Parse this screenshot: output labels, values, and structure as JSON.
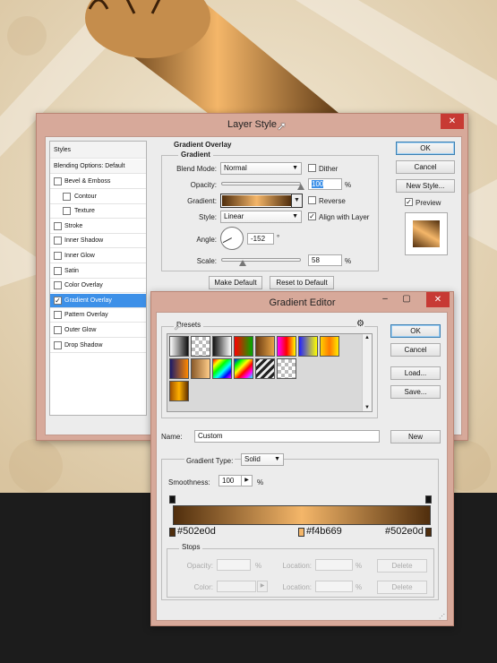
{
  "layer_style": {
    "title": "Layer Style",
    "styles_header": "Styles",
    "blending_options": "Blending Options: Default",
    "styles": [
      {
        "label": "Bevel & Emboss",
        "checked": false,
        "indent": false
      },
      {
        "label": "Contour",
        "checked": false,
        "indent": true
      },
      {
        "label": "Texture",
        "checked": false,
        "indent": true
      },
      {
        "label": "Stroke",
        "checked": false,
        "indent": false
      },
      {
        "label": "Inner Shadow",
        "checked": false,
        "indent": false
      },
      {
        "label": "Inner Glow",
        "checked": false,
        "indent": false
      },
      {
        "label": "Satin",
        "checked": false,
        "indent": false
      },
      {
        "label": "Color Overlay",
        "checked": false,
        "indent": false
      },
      {
        "label": "Gradient Overlay",
        "checked": true,
        "indent": false
      },
      {
        "label": "Pattern Overlay",
        "checked": false,
        "indent": false
      },
      {
        "label": "Outer Glow",
        "checked": false,
        "indent": false
      },
      {
        "label": "Drop Shadow",
        "checked": false,
        "indent": false
      }
    ],
    "section_title": "Gradient Overlay",
    "group_title": "Gradient",
    "blend_mode_label": "Blend Mode:",
    "blend_mode_value": "Normal",
    "dither_label": "Dither",
    "opacity_label": "Opacity:",
    "opacity_value": "100",
    "opacity_unit": "%",
    "gradient_label": "Gradient:",
    "reverse_label": "Reverse",
    "style_label": "Style:",
    "style_value": "Linear",
    "align_label": "Align with Layer",
    "angle_label": "Angle:",
    "angle_value": "-152",
    "angle_unit": "°",
    "scale_label": "Scale:",
    "scale_value": "58",
    "scale_unit": "%",
    "make_default": "Make Default",
    "reset_default": "Reset to Default",
    "ok": "OK",
    "cancel": "Cancel",
    "new_style": "New Style...",
    "preview_label": "Preview",
    "preview_checked": true,
    "dither_checked": false,
    "reverse_checked": false,
    "align_checked": true,
    "opacity_fraction": 1.0,
    "scale_fraction": 0.58
  },
  "gradient_editor": {
    "title": "Gradient Editor",
    "presets_label": "Presets",
    "ok": "OK",
    "cancel": "Cancel",
    "load": "Load...",
    "save": "Save...",
    "name_label": "Name:",
    "name_value": "Custom",
    "new_button": "New",
    "type_label": "Gradient Type:",
    "type_value": "Solid",
    "smoothness_label": "Smoothness:",
    "smoothness_value": "100",
    "smoothness_unit": "%",
    "stops_title": "Stops",
    "opacity_label": "Opacity:",
    "opacity_unit": "%",
    "location_label": "Location:",
    "location_unit": "%",
    "delete_label": "Delete",
    "color_label": "Color:",
    "color_stops": [
      {
        "hex": "#502e0d",
        "location": 0
      },
      {
        "hex": "#f4b669",
        "location": 50
      },
      {
        "hex": "#502e0d",
        "location": 100
      }
    ],
    "presets": [
      "#ffffff,#111111",
      "checker",
      "#111111,#ffffff",
      "#ff0000,#00aa00",
      "#6b3c12,#e8a447",
      "#ff00ff,#ff0000,#ffff00",
      "#2020ff,#ffff00",
      "#ffd000,#ff7a00,#ffea00",
      "#1a1a6a,#ff8800",
      "#8a5a2a,#ffcc88",
      "rainbow1",
      "rainbow2",
      "stripes",
      "checker",
      "#a05000,#ffb000,#603000"
    ]
  },
  "colors": {
    "window_frame": "#d7a99a",
    "close_button": "#c73a34",
    "selection": "#3d90e8",
    "gradient_dark": "#502e0d",
    "gradient_light": "#f4b669"
  }
}
